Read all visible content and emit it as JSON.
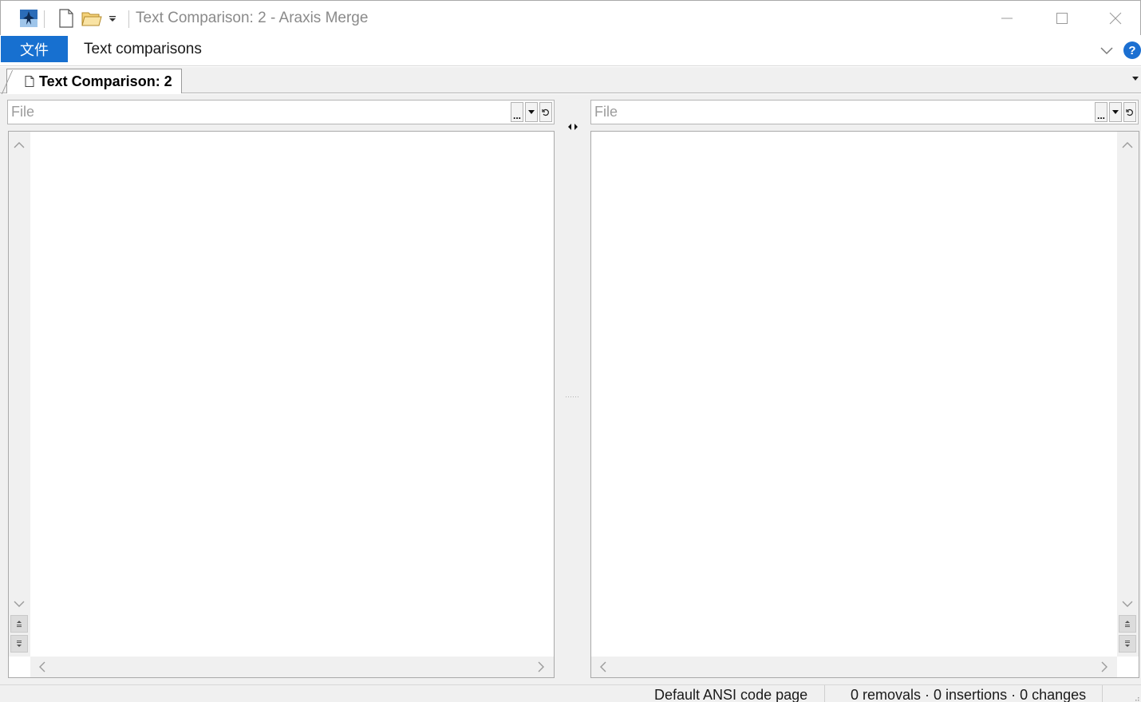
{
  "window": {
    "title": "Text Comparison: 2 - Araxis Merge",
    "icons": [
      "araxis-app-icon",
      "new-document-icon",
      "open-folder-icon",
      "customize-dropdown-icon",
      "minimize-icon",
      "maximize-icon",
      "close-icon"
    ]
  },
  "ribbon": {
    "file_tab": "文件",
    "tabs": [
      "Text comparisons"
    ],
    "help_label": "?",
    "accent_color": "#1770d0"
  },
  "document_tabs": [
    {
      "label": "Text Comparison: 2",
      "active": true
    }
  ],
  "left_file": {
    "placeholder": "File",
    "browse_label": "..."
  },
  "right_file": {
    "placeholder": "File",
    "browse_label": "..."
  },
  "status": {
    "encoding": "Default ANSI code page",
    "stats": "0 removals · 0 insertions · 0 changes"
  }
}
